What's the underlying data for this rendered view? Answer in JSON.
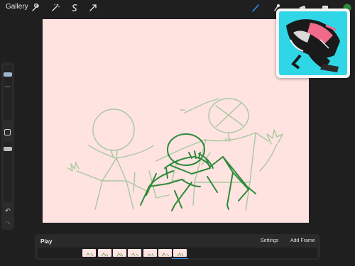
{
  "topbar": {
    "gallery_label": "Gallery",
    "left_tools": [
      "wrench-icon",
      "magic-wand-icon",
      "selection-icon",
      "transform-icon"
    ],
    "right_tools": [
      "brush-icon",
      "smudge-icon",
      "eraser-icon",
      "layers-icon",
      "color-swatch"
    ],
    "active_tool_color": "#2e7bd6",
    "current_color": "#2e8a3a"
  },
  "sidebar": {
    "items": [
      "brush-size-slider",
      "modify-button",
      "opacity-slider",
      "undo-icon",
      "redo-icon"
    ]
  },
  "canvas": {
    "background": "#ffe3e1",
    "onion_skin_color": "#a8c8a0",
    "active_stroke_color": "#2e8a3a"
  },
  "reference": {
    "label": ""
  },
  "animation": {
    "play_label": "Play",
    "settings_label": "Settings",
    "add_frame_label": "Add Frame",
    "frame_count": 7,
    "selected_frame": 7
  }
}
